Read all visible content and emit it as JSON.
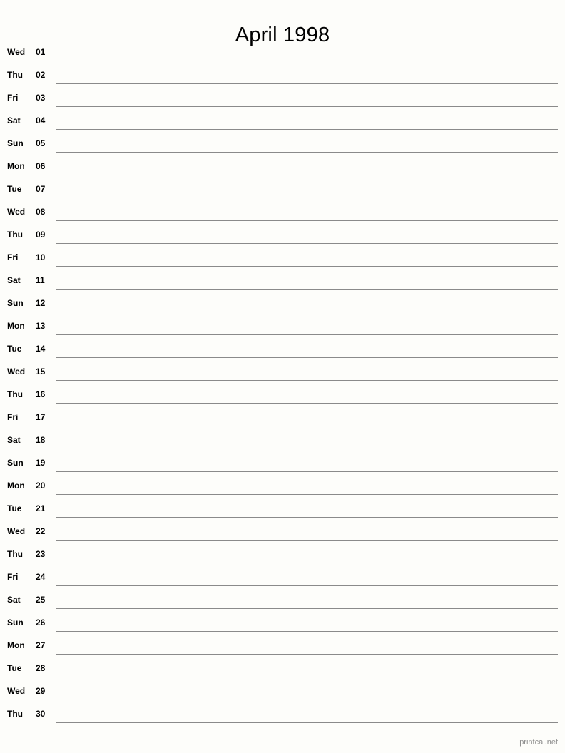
{
  "page": {
    "title": "April 1998",
    "background_color": "#fdfdfa",
    "rule_color": "#8a8a8a",
    "text_color": "#000000",
    "footer_color": "#8d8d8d"
  },
  "footer": {
    "credit": "printcal.net"
  },
  "calendar": {
    "month": "April",
    "year": "1998",
    "days": [
      {
        "dow": "Wed",
        "dom": "01",
        "note": ""
      },
      {
        "dow": "Thu",
        "dom": "02",
        "note": ""
      },
      {
        "dow": "Fri",
        "dom": "03",
        "note": ""
      },
      {
        "dow": "Sat",
        "dom": "04",
        "note": ""
      },
      {
        "dow": "Sun",
        "dom": "05",
        "note": ""
      },
      {
        "dow": "Mon",
        "dom": "06",
        "note": ""
      },
      {
        "dow": "Tue",
        "dom": "07",
        "note": ""
      },
      {
        "dow": "Wed",
        "dom": "08",
        "note": ""
      },
      {
        "dow": "Thu",
        "dom": "09",
        "note": ""
      },
      {
        "dow": "Fri",
        "dom": "10",
        "note": ""
      },
      {
        "dow": "Sat",
        "dom": "11",
        "note": ""
      },
      {
        "dow": "Sun",
        "dom": "12",
        "note": ""
      },
      {
        "dow": "Mon",
        "dom": "13",
        "note": ""
      },
      {
        "dow": "Tue",
        "dom": "14",
        "note": ""
      },
      {
        "dow": "Wed",
        "dom": "15",
        "note": ""
      },
      {
        "dow": "Thu",
        "dom": "16",
        "note": ""
      },
      {
        "dow": "Fri",
        "dom": "17",
        "note": ""
      },
      {
        "dow": "Sat",
        "dom": "18",
        "note": ""
      },
      {
        "dow": "Sun",
        "dom": "19",
        "note": ""
      },
      {
        "dow": "Mon",
        "dom": "20",
        "note": ""
      },
      {
        "dow": "Tue",
        "dom": "21",
        "note": ""
      },
      {
        "dow": "Wed",
        "dom": "22",
        "note": ""
      },
      {
        "dow": "Thu",
        "dom": "23",
        "note": ""
      },
      {
        "dow": "Fri",
        "dom": "24",
        "note": ""
      },
      {
        "dow": "Sat",
        "dom": "25",
        "note": ""
      },
      {
        "dow": "Sun",
        "dom": "26",
        "note": ""
      },
      {
        "dow": "Mon",
        "dom": "27",
        "note": ""
      },
      {
        "dow": "Tue",
        "dom": "28",
        "note": ""
      },
      {
        "dow": "Wed",
        "dom": "29",
        "note": ""
      },
      {
        "dow": "Thu",
        "dom": "30",
        "note": ""
      }
    ]
  }
}
